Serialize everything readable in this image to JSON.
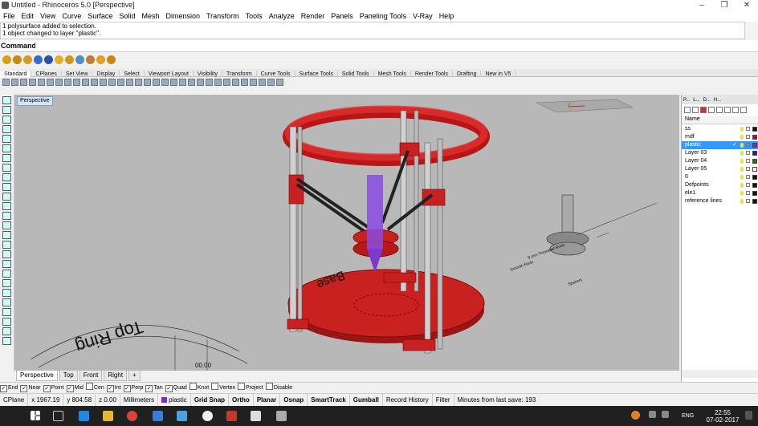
{
  "window": {
    "title": "Untitled - Rhinoceros 5.0  [Perspective]",
    "minimize": "–",
    "maximize": "❐",
    "close": "✕"
  },
  "menu": [
    "File",
    "Edit",
    "View",
    "Curve",
    "Surface",
    "Solid",
    "Mesh",
    "Dimension",
    "Transform",
    "Tools",
    "Analyze",
    "Render",
    "Panels",
    "Paneling Tools",
    "V-Ray",
    "Help"
  ],
  "history": [
    "1 polysurface added to selection.",
    "1 object changed to layer \"plastic\"."
  ],
  "command": {
    "label": "Command:",
    "value": ""
  },
  "toolbar_tabs": [
    "Standard",
    "CPlanes",
    "Set View",
    "Display",
    "Select",
    "Viewport Layout",
    "Visibility",
    "Transform",
    "Curve Tools",
    "Surface Tools",
    "Solid Tools",
    "Mesh Tools",
    "Render Tools",
    "Drafting",
    "New in V5"
  ],
  "viewport": {
    "title": "Perspective",
    "label_base": "Base",
    "label_top_ring": "Top Ring",
    "dim_text": "00.00",
    "note_lines": [
      "8 mm Threaded Rods",
      "Smooth Rods",
      "Spacers"
    ]
  },
  "viewport_tabs": [
    "Perspective",
    "Top",
    "Front",
    "Right",
    "+"
  ],
  "osnap": [
    {
      "label": "End",
      "checked": true
    },
    {
      "label": "Near",
      "checked": true
    },
    {
      "label": "Point",
      "checked": true
    },
    {
      "label": "Mid",
      "checked": true
    },
    {
      "label": "Cen",
      "checked": false
    },
    {
      "label": "Int",
      "checked": true
    },
    {
      "label": "Perp",
      "checked": true
    },
    {
      "label": "Tan",
      "checked": true
    },
    {
      "label": "Quad",
      "checked": true
    },
    {
      "label": "Knot",
      "checked": false
    },
    {
      "label": "Vertex",
      "checked": false
    },
    {
      "label": "Project",
      "checked": false
    },
    {
      "label": "Disable",
      "checked": false
    }
  ],
  "status": {
    "cplane": "CPlane",
    "x": "x 1967.19",
    "y": "y 804.58",
    "z": "z 0.00",
    "units": "Millimeters",
    "layer": "plastic",
    "toggles": [
      "Grid Snap",
      "Ortho",
      "Planar",
      "Osnap",
      "SmartTrack",
      "Gumball",
      "Record History",
      "Filter"
    ],
    "save_info": "Minutes from last save: 193"
  },
  "panel": {
    "tabs": [
      "P...",
      "L...",
      "D...",
      "H..."
    ],
    "header": "Name",
    "layers": [
      {
        "name": "ss",
        "color": "#111111",
        "selected": false,
        "current": false
      },
      {
        "name": "mdf",
        "color": "#8b1a1a",
        "selected": false,
        "current": false
      },
      {
        "name": "plastic",
        "color": "#7b2fbe",
        "selected": true,
        "current": true
      },
      {
        "name": "Layer 03",
        "color": "#1a1acc",
        "selected": false,
        "current": false
      },
      {
        "name": "Layer 04",
        "color": "#1a7a1a",
        "selected": false,
        "current": false
      },
      {
        "name": "Layer 05",
        "color": "#ffffff",
        "selected": false,
        "current": false
      },
      {
        "name": "0",
        "color": "#111111",
        "selected": false,
        "current": false
      },
      {
        "name": "Defpoints",
        "color": "#111111",
        "selected": false,
        "current": false
      },
      {
        "name": "ele1",
        "color": "#111111",
        "selected": false,
        "current": false
      },
      {
        "name": "reference lines",
        "color": "#111111",
        "selected": false,
        "current": false
      }
    ],
    "current_mark": "✓"
  },
  "taskbar": {
    "time": "22:55",
    "date": "07-02-2017",
    "lang": "ENG"
  }
}
